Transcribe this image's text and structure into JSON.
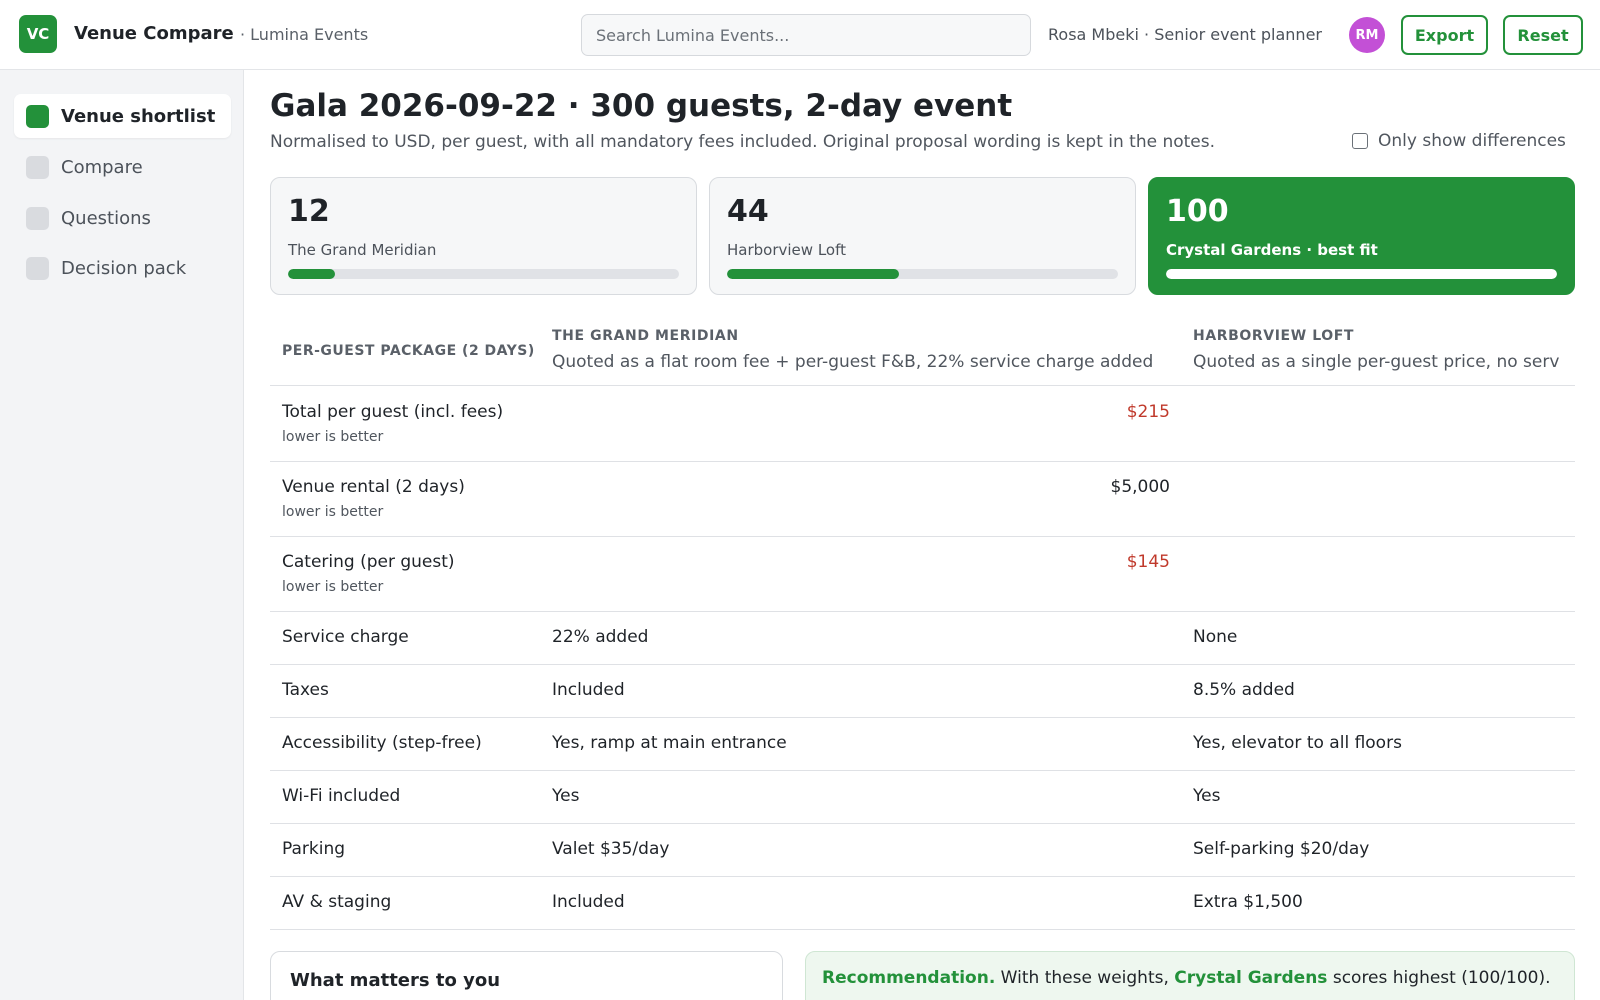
{
  "app": {
    "logo_text": "VC",
    "title": "Venue Compare",
    "workspace": "· Lumina Events",
    "search_placeholder": "Search Lumina Events...",
    "user": "Rosa Mbeki · Senior event planner",
    "avatar_initials": "RM",
    "export_label": "Export",
    "reset_label": "Reset"
  },
  "sidebar": {
    "items": [
      {
        "label": "Venue shortlist",
        "active": true
      },
      {
        "label": "Compare",
        "active": false
      },
      {
        "label": "Questions",
        "active": false
      },
      {
        "label": "Decision pack",
        "active": false
      }
    ]
  },
  "main": {
    "title": "Gala 2026-09-22 · 300 guests, 2-day event",
    "subtitle": "Normalised to USD, per guest, with all mandatory fees included. Original proposal wording is kept in the notes.",
    "diff_toggle_label": "Only show differences",
    "diff_toggle_checked": false
  },
  "scores": [
    {
      "score": "12",
      "name": "The Grand Meridian",
      "fraction": 0.12,
      "best": false
    },
    {
      "score": "44",
      "name": "Harborview Loft",
      "fraction": 0.44,
      "best": false
    },
    {
      "score": "100",
      "name": "Crystal Gardens · best fit",
      "fraction": 1.0,
      "best": true
    }
  ],
  "table": {
    "header_label": "PER-GUEST PACKAGE (2 DAYS)",
    "venues": [
      {
        "name": "THE GRAND MERIDIAN",
        "note": "Quoted as a flat room fee + per-guest F&B, 22% service charge added"
      },
      {
        "name": "HARBORVIEW LOFT",
        "note": "Quoted as a single per-guest price, no serv"
      }
    ],
    "numeric_rows": [
      {
        "label": "Total per guest (incl. fees)",
        "hint": "lower is better",
        "value": "$215",
        "worse": true
      },
      {
        "label": "Venue rental (2 days)",
        "hint": "lower is better",
        "value": "$5,000",
        "worse": false
      },
      {
        "label": "Catering (per guest)",
        "hint": "lower is better",
        "value": "$145",
        "worse": true
      }
    ],
    "text_rows": [
      {
        "label": "Service charge",
        "values": [
          "22% added",
          "None"
        ]
      },
      {
        "label": "Taxes",
        "values": [
          "Included",
          "8.5% added"
        ]
      },
      {
        "label": "Accessibility (step-free)",
        "values": [
          "Yes, ramp at main entrance",
          "Yes, elevator to all floors"
        ]
      },
      {
        "label": "Wi-Fi included",
        "values": [
          "Yes",
          "Yes"
        ]
      },
      {
        "label": "Parking",
        "values": [
          "Valet $35/day",
          "Self-parking $20/day"
        ]
      },
      {
        "label": "AV & staging",
        "values": [
          "Included",
          "Extra $1,500"
        ]
      }
    ]
  },
  "panels": {
    "matters_title": "What matters to you",
    "rec_lead": "Recommendation.",
    "rec_text_1": " With these weights, ",
    "rec_venue": "Crystal Gardens",
    "rec_text_2": " scores highest (100/100)."
  },
  "colors": {
    "accent": "#23913a",
    "worse_value": "#c0392b",
    "avatar": "#c350d6"
  }
}
